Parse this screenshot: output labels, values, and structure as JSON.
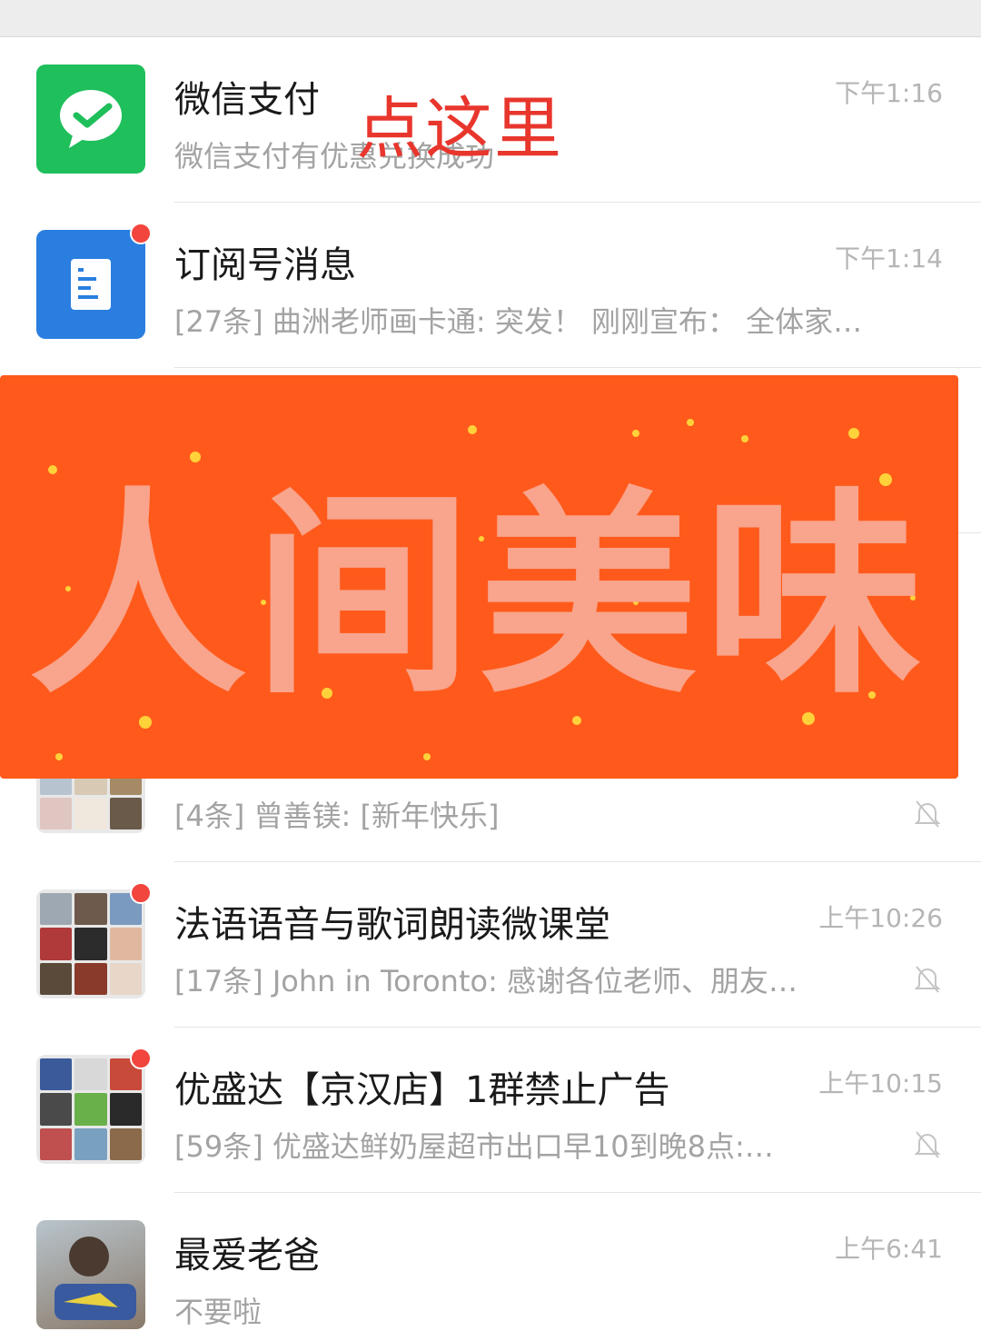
{
  "annotation": "点这里",
  "banner": {
    "text": "人间美味"
  },
  "chats": [
    {
      "title": "微信支付",
      "preview": "微信支付有优惠兑换成功",
      "time": "下午1:16",
      "icon": "wechat-pay-icon",
      "unread": false,
      "muted": false
    },
    {
      "title": "订阅号消息",
      "preview": "[27条] 曲洲老师画卡通: 突发！ 刚刚宣布： 全体家…",
      "time": "下午1:14",
      "icon": "subscription-document-icon",
      "unread": true,
      "muted": false
    },
    {
      "title": "",
      "preview": "[4条] 曾善镁: [新年快乐]",
      "time": "",
      "icon": "group-avatar",
      "unread": false,
      "muted": true
    },
    {
      "title": "法语语音与歌词朗读微课堂",
      "preview": "[17条] John in Toronto: 感谢各位老师、朋友…",
      "time": "上午10:26",
      "icon": "group-avatar",
      "unread": true,
      "muted": true
    },
    {
      "title": "优盛达【京汉店】1群禁止广告",
      "preview": "[59条] 优盛达鲜奶屋超市出口早10到晚8点:…",
      "time": "上午10:15",
      "icon": "group-avatar",
      "unread": true,
      "muted": true
    },
    {
      "title": "最爱老爸",
      "preview": "不要啦",
      "time": "上午6:41",
      "icon": "person-avatar",
      "unread": false,
      "muted": false
    }
  ],
  "colors": {
    "wechat_pay": "#1fbf5c",
    "subscription": "#2a7ee0",
    "badge": "#f2453d",
    "banner": "#ff5a1c",
    "banner_text": "#f9a48c",
    "annotation": "#e8362d"
  }
}
